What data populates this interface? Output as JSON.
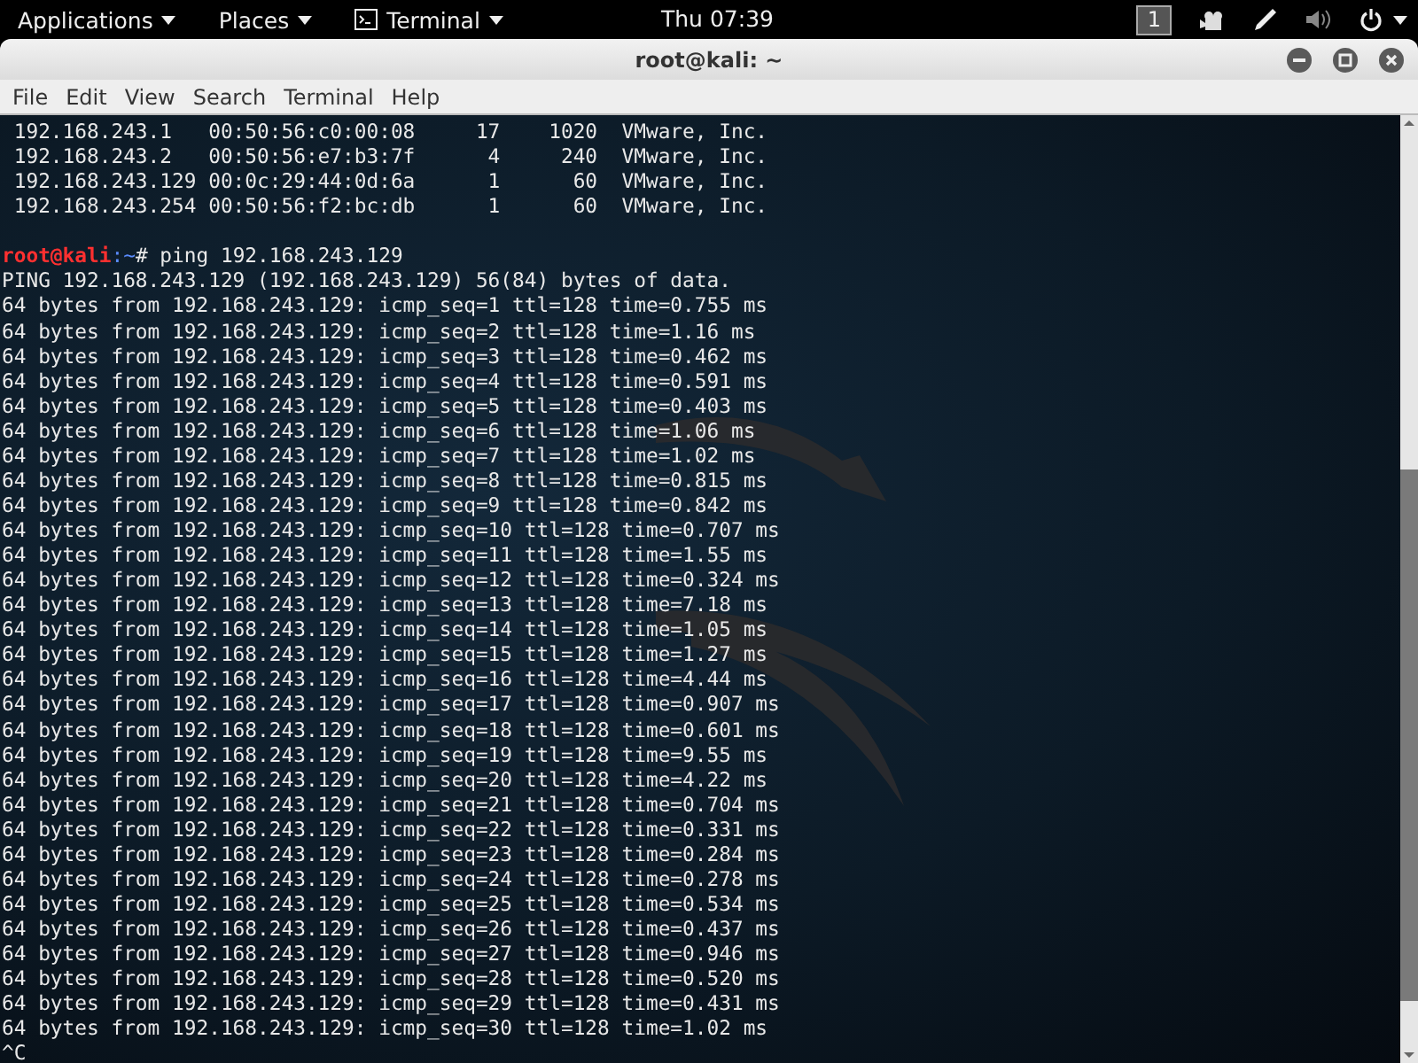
{
  "top_bar": {
    "menus": [
      {
        "label": "Applications",
        "kind": "plain"
      },
      {
        "label": "Places",
        "kind": "plain"
      },
      {
        "label": "Terminal",
        "kind": "app"
      }
    ],
    "clock": "Thu 07:39",
    "workspace": "1"
  },
  "window": {
    "title": "root@kali: ~"
  },
  "menu_bar": [
    "File",
    "Edit",
    "View",
    "Search",
    "Terminal",
    "Help"
  ],
  "terminal": {
    "lines": [
      {
        "kind": "text",
        "text": " 192.168.243.1   00:50:56:c0:00:08     17    1020  VMware, Inc."
      },
      {
        "kind": "text",
        "text": " 192.168.243.2   00:50:56:e7:b3:7f      4     240  VMware, Inc."
      },
      {
        "kind": "text",
        "text": " 192.168.243.129 00:0c:29:44:0d:6a      1      60  VMware, Inc."
      },
      {
        "kind": "text",
        "text": " 192.168.243.254 00:50:56:f2:bc:db      1      60  VMware, Inc."
      },
      {
        "kind": "blank"
      },
      {
        "kind": "prompt",
        "user": "root@kali",
        "path": ":~",
        "symbol": "#",
        "command": " ping 192.168.243.129"
      },
      {
        "kind": "text",
        "text": "PING 192.168.243.129 (192.168.243.129) 56(84) bytes of data."
      },
      {
        "kind": "text",
        "text": "64 bytes from 192.168.243.129: icmp_seq=1 ttl=128 time=0.755 ms"
      },
      {
        "kind": "text",
        "text": "64 bytes from 192.168.243.129: icmp_seq=2 ttl=128 time=1.16 ms"
      },
      {
        "kind": "text",
        "text": "64 bytes from 192.168.243.129: icmp_seq=3 ttl=128 time=0.462 ms"
      },
      {
        "kind": "text",
        "text": "64 bytes from 192.168.243.129: icmp_seq=4 ttl=128 time=0.591 ms"
      },
      {
        "kind": "text",
        "text": "64 bytes from 192.168.243.129: icmp_seq=5 ttl=128 time=0.403 ms"
      },
      {
        "kind": "text",
        "text": "64 bytes from 192.168.243.129: icmp_seq=6 ttl=128 time=1.06 ms"
      },
      {
        "kind": "text",
        "text": "64 bytes from 192.168.243.129: icmp_seq=7 ttl=128 time=1.02 ms"
      },
      {
        "kind": "text",
        "text": "64 bytes from 192.168.243.129: icmp_seq=8 ttl=128 time=0.815 ms"
      },
      {
        "kind": "text",
        "text": "64 bytes from 192.168.243.129: icmp_seq=9 ttl=128 time=0.842 ms"
      },
      {
        "kind": "text",
        "text": "64 bytes from 192.168.243.129: icmp_seq=10 ttl=128 time=0.707 ms"
      },
      {
        "kind": "text",
        "text": "64 bytes from 192.168.243.129: icmp_seq=11 ttl=128 time=1.55 ms"
      },
      {
        "kind": "text",
        "text": "64 bytes from 192.168.243.129: icmp_seq=12 ttl=128 time=0.324 ms"
      },
      {
        "kind": "text",
        "text": "64 bytes from 192.168.243.129: icmp_seq=13 ttl=128 time=7.18 ms"
      },
      {
        "kind": "text",
        "text": "64 bytes from 192.168.243.129: icmp_seq=14 ttl=128 time=1.05 ms"
      },
      {
        "kind": "text",
        "text": "64 bytes from 192.168.243.129: icmp_seq=15 ttl=128 time=1.27 ms"
      },
      {
        "kind": "text",
        "text": "64 bytes from 192.168.243.129: icmp_seq=16 ttl=128 time=4.44 ms"
      },
      {
        "kind": "text",
        "text": "64 bytes from 192.168.243.129: icmp_seq=17 ttl=128 time=0.907 ms"
      },
      {
        "kind": "text",
        "text": "64 bytes from 192.168.243.129: icmp_seq=18 ttl=128 time=0.601 ms"
      },
      {
        "kind": "text",
        "text": "64 bytes from 192.168.243.129: icmp_seq=19 ttl=128 time=9.55 ms"
      },
      {
        "kind": "text",
        "text": "64 bytes from 192.168.243.129: icmp_seq=20 ttl=128 time=4.22 ms"
      },
      {
        "kind": "text",
        "text": "64 bytes from 192.168.243.129: icmp_seq=21 ttl=128 time=0.704 ms"
      },
      {
        "kind": "text",
        "text": "64 bytes from 192.168.243.129: icmp_seq=22 ttl=128 time=0.331 ms"
      },
      {
        "kind": "text",
        "text": "64 bytes from 192.168.243.129: icmp_seq=23 ttl=128 time=0.284 ms"
      },
      {
        "kind": "text",
        "text": "64 bytes from 192.168.243.129: icmp_seq=24 ttl=128 time=0.278 ms"
      },
      {
        "kind": "text",
        "text": "64 bytes from 192.168.243.129: icmp_seq=25 ttl=128 time=0.534 ms"
      },
      {
        "kind": "text",
        "text": "64 bytes from 192.168.243.129: icmp_seq=26 ttl=128 time=0.437 ms"
      },
      {
        "kind": "text",
        "text": "64 bytes from 192.168.243.129: icmp_seq=27 ttl=128 time=0.946 ms"
      },
      {
        "kind": "text",
        "text": "64 bytes from 192.168.243.129: icmp_seq=28 ttl=128 time=0.520 ms"
      },
      {
        "kind": "text",
        "text": "64 bytes from 192.168.243.129: icmp_seq=29 ttl=128 time=0.431 ms"
      },
      {
        "kind": "text",
        "text": "64 bytes from 192.168.243.129: icmp_seq=30 ttl=128 time=1.02 ms"
      },
      {
        "kind": "text",
        "text": "^C"
      }
    ]
  }
}
